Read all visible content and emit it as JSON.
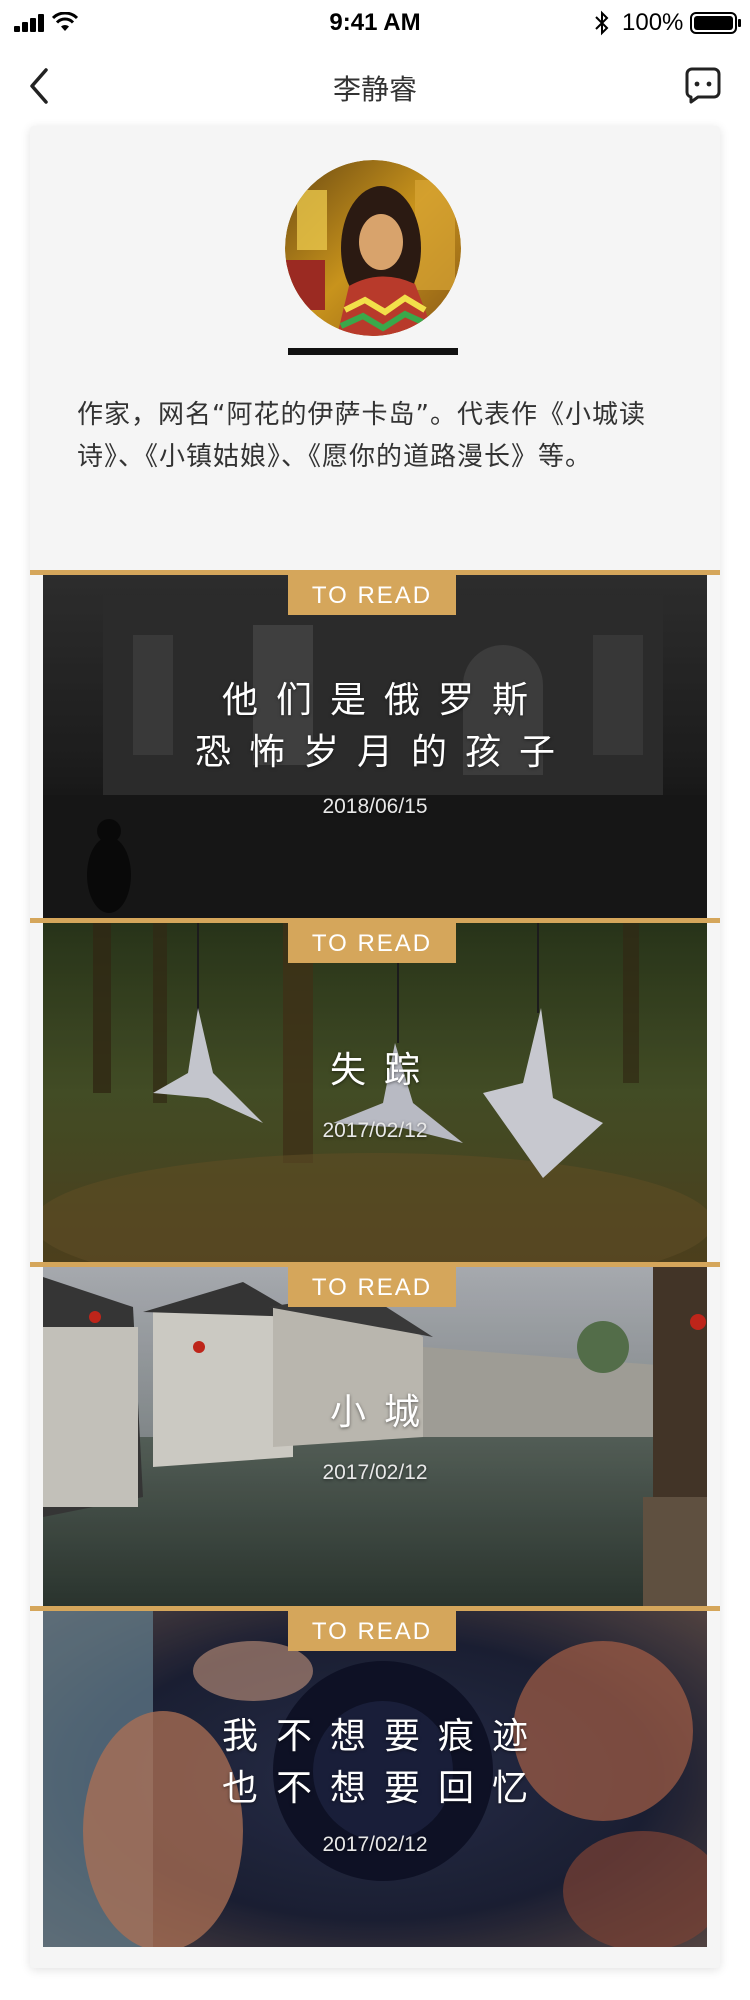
{
  "status_bar": {
    "time": "9:41 AM",
    "battery": "100%",
    "icons": [
      "signal-icon",
      "wifi-icon",
      "bluetooth-icon",
      "battery-icon"
    ]
  },
  "nav": {
    "title": "李静睿",
    "back_icon": "chevron-left-icon",
    "more_icon": "chat-bubble-icon"
  },
  "profile": {
    "bio": "作家，网名“阿花的伊萨卡岛”。代表作《小城读诗》、《小镇姑娘》、《愿你的道路漫长》等。"
  },
  "articles": [
    {
      "tag": "TO READ",
      "title_line1": "他们是俄罗斯",
      "title_line2": "恐怖岁月的孩子",
      "date": "2018/06/15"
    },
    {
      "tag": "TO READ",
      "title_line1": "失踪",
      "title_line2": "",
      "date": "2017/02/12"
    },
    {
      "tag": "TO READ",
      "title_line1": "小城",
      "title_line2": "",
      "date": "2017/02/12"
    },
    {
      "tag": "TO READ",
      "title_line1": "我不想要痕迹",
      "title_line2": "也不想要回忆",
      "date": "2017/02/12"
    }
  ],
  "colors": {
    "accent": "#d5a65b",
    "card_bg": "#f5f5f5"
  }
}
